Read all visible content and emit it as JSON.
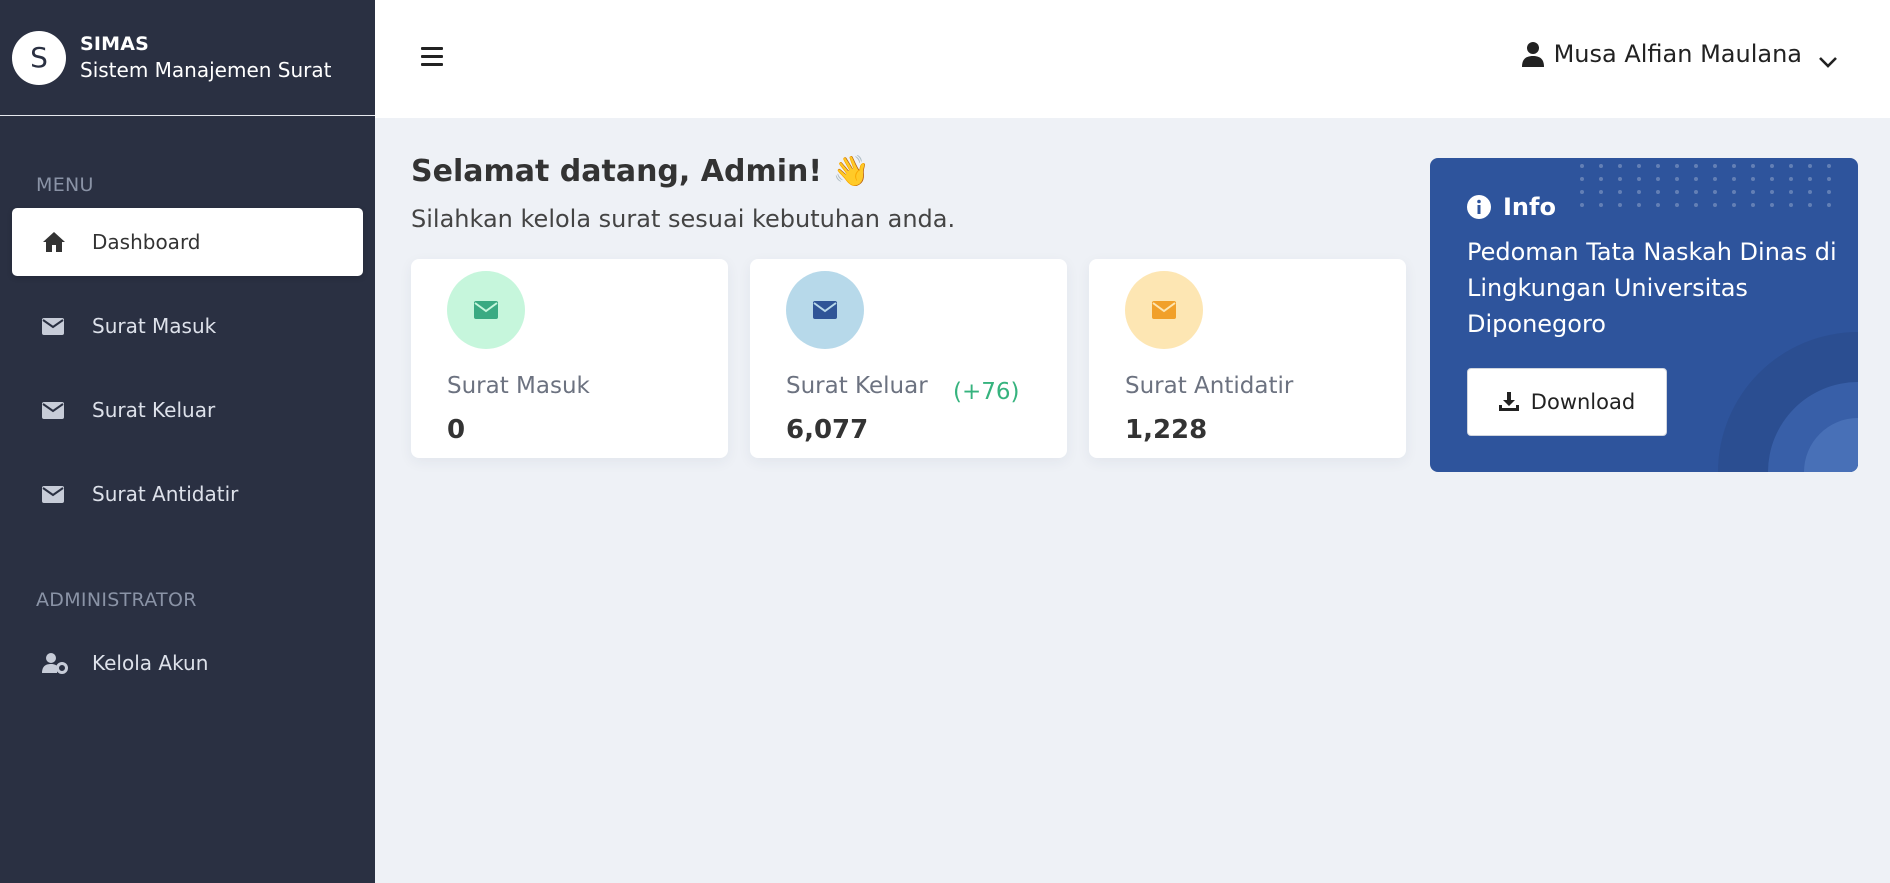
{
  "brand": {
    "logo_letter": "S",
    "name": "SIMAS",
    "subtitle": "Sistem Manajemen Surat"
  },
  "sidebar": {
    "menu_label": "MENU",
    "items": [
      {
        "label": "Dashboard",
        "icon": "home-icon",
        "active": true
      },
      {
        "label": "Surat Masuk",
        "icon": "envelope-icon"
      },
      {
        "label": "Surat Keluar",
        "icon": "envelope-icon"
      },
      {
        "label": "Surat Antidatir",
        "icon": "envelope-icon"
      }
    ],
    "admin_label": "ADMINISTRATOR",
    "admin_items": [
      {
        "label": "Kelola Akun",
        "icon": "user-gear-icon"
      }
    ]
  },
  "topbar": {
    "user_name": "Musa Alfian Maulana"
  },
  "welcome": {
    "title": "Selamat datang, Admin! 👋",
    "subtitle": "Silahkan kelola surat sesuai kebutuhan anda."
  },
  "stats": [
    {
      "label": "Surat Masuk",
      "value": "0",
      "delta": "",
      "icon_bg": "#c6f6dc",
      "icon_color": "#3aaa82"
    },
    {
      "label": "Surat Keluar",
      "value": "6,077",
      "delta": "(+76)",
      "icon_bg": "#b7d9ea",
      "icon_color": "#2f5597"
    },
    {
      "label": "Surat Antidatir",
      "value": "1,228",
      "delta": "",
      "icon_bg": "#fde6b3",
      "icon_color": "#f1a02a"
    }
  ],
  "info": {
    "title": "Info",
    "text": "Pedoman Tata Naskah Dinas di Lingkungan Universitas Diponegoro",
    "button_label": "Download"
  },
  "colors": {
    "sidebar_bg": "#2a3042",
    "info_bg": "#2e549c",
    "page_bg": "#eef1f6",
    "positive": "#36b37e"
  }
}
